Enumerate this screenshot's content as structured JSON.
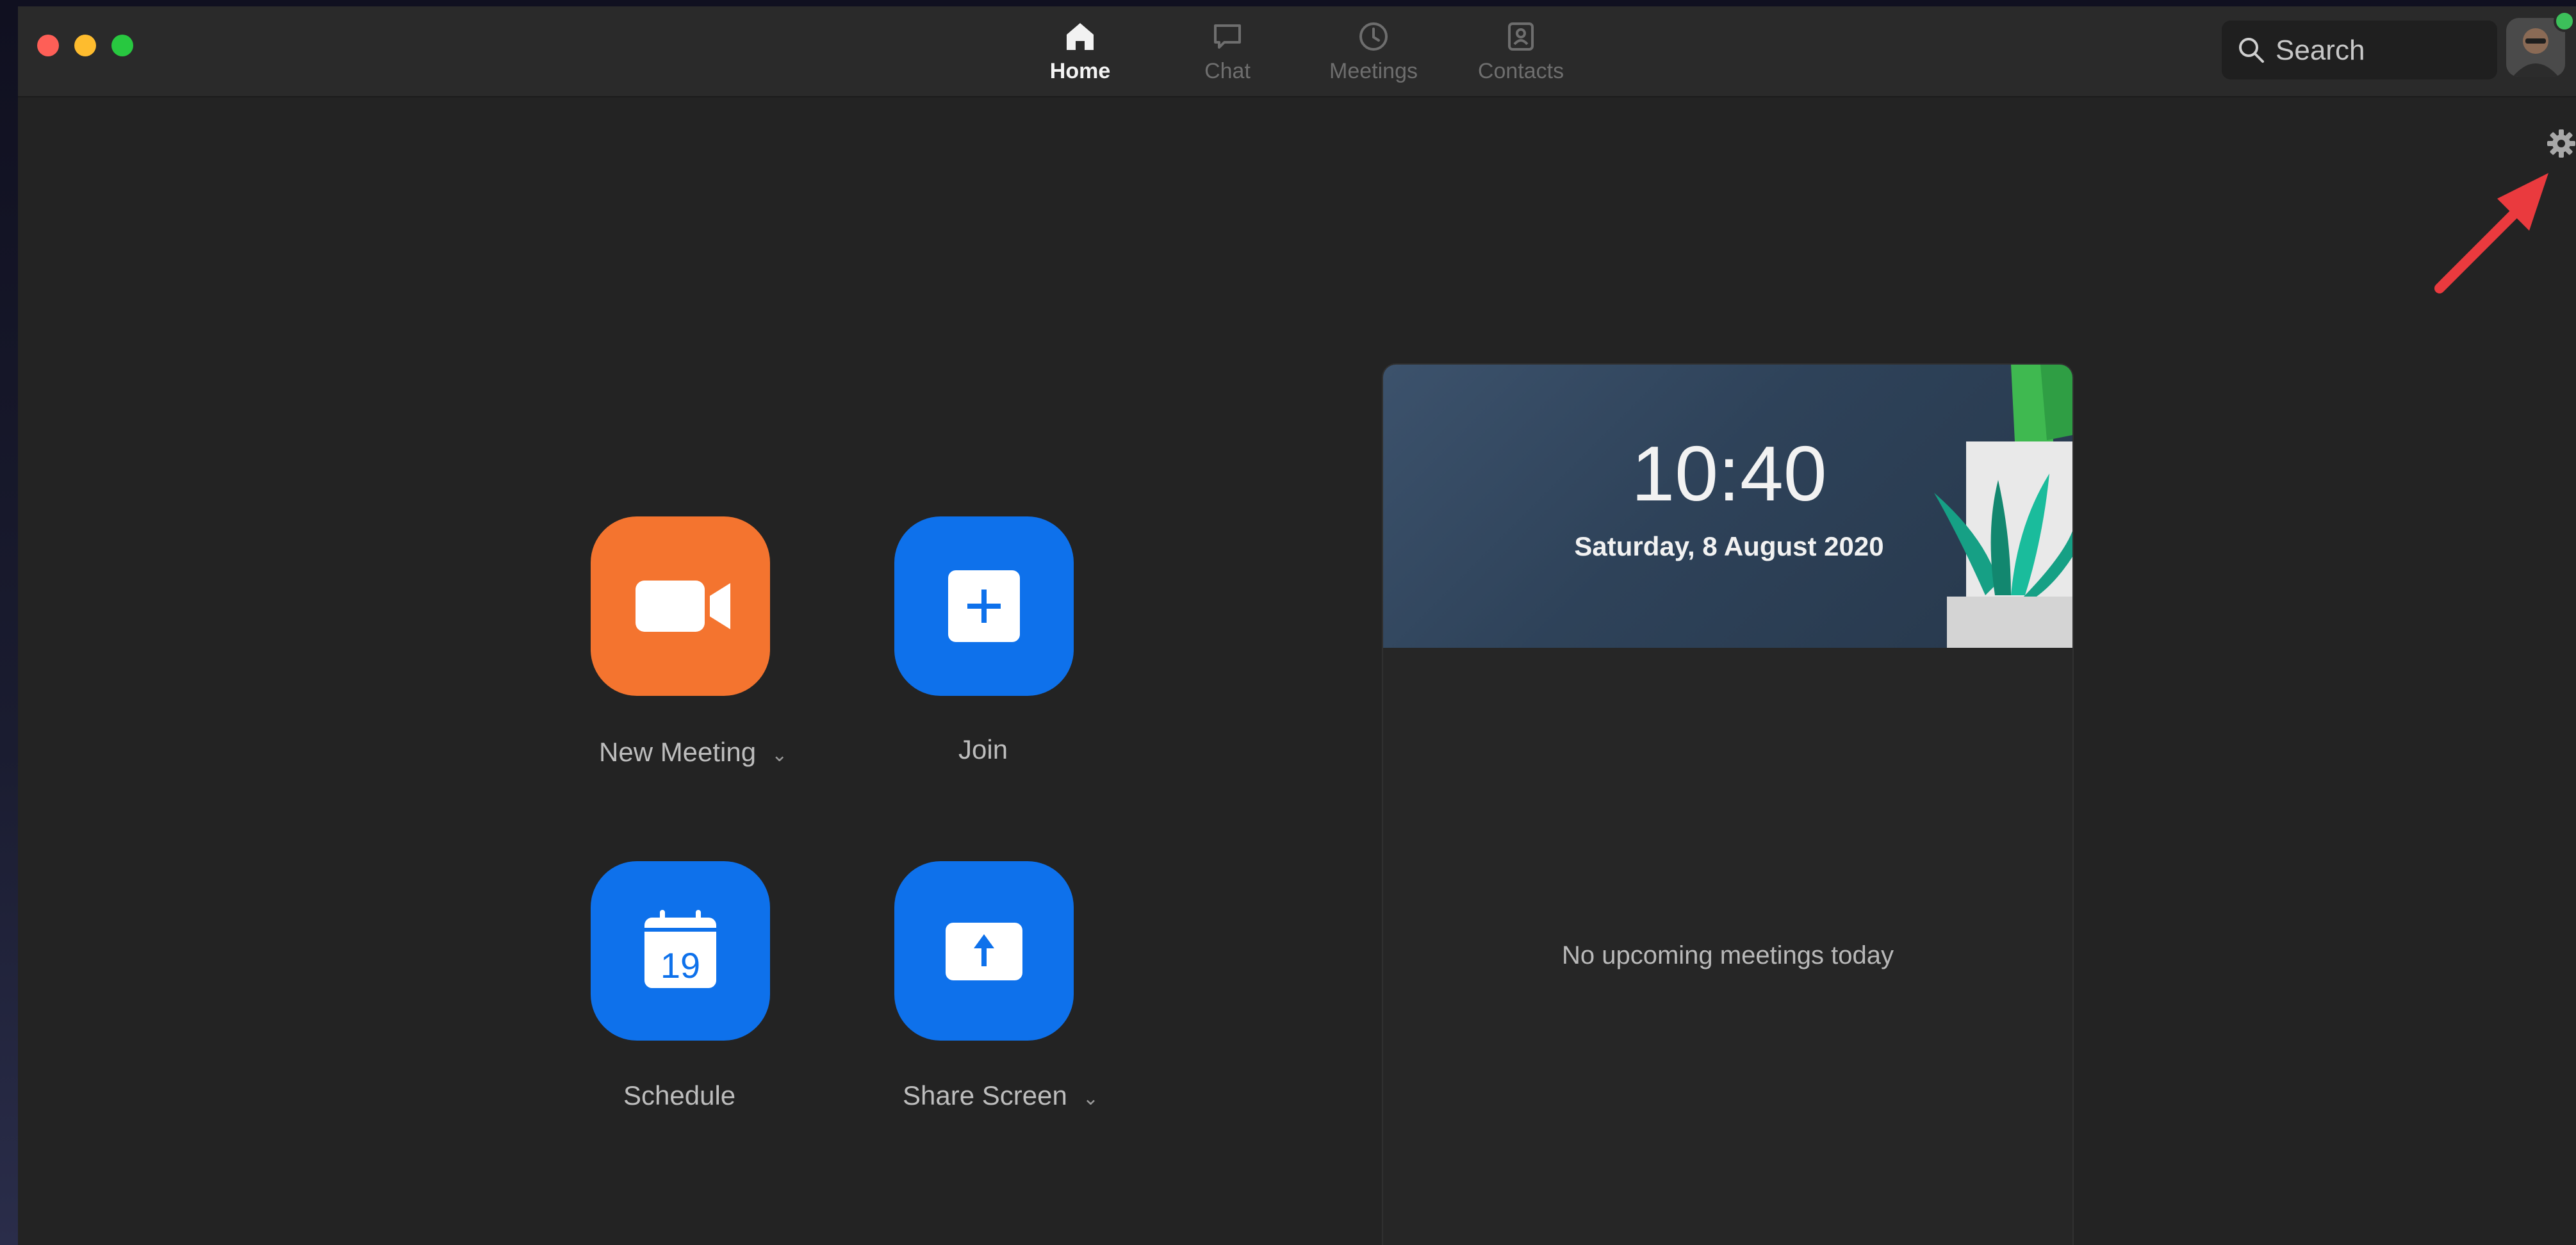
{
  "nav": {
    "tabs": [
      {
        "label": "Home",
        "icon": "home-icon",
        "active": true
      },
      {
        "label": "Chat",
        "icon": "chat-icon",
        "active": false
      },
      {
        "label": "Meetings",
        "icon": "clock-icon",
        "active": false
      },
      {
        "label": "Contacts",
        "icon": "contacts-icon",
        "active": false
      }
    ]
  },
  "search": {
    "placeholder": "Search",
    "value": ""
  },
  "actions": {
    "new_meeting": {
      "label": "New Meeting",
      "caret": "⌄",
      "icon": "video-camera-icon",
      "color": "#f4742f"
    },
    "join": {
      "label": "Join",
      "icon": "plus-icon",
      "color": "#0e71eb"
    },
    "schedule": {
      "label": "Schedule",
      "icon": "calendar-icon",
      "calendar_day": "19",
      "color": "#0e71eb"
    },
    "share_screen": {
      "label": "Share Screen",
      "caret": "⌄",
      "icon": "upload-arrow-icon",
      "color": "#0e71eb"
    }
  },
  "calendar": {
    "time": "10:40",
    "date": "Saturday, 8 August 2020",
    "empty_message": "No upcoming meetings today"
  },
  "colors": {
    "window_bg": "#232323",
    "titlebar_bg": "#2a2a2a",
    "accent_blue": "#0e71eb",
    "accent_orange": "#f4742f",
    "status_online": "#3cc05a",
    "annotation_red": "#ea3a3e"
  }
}
